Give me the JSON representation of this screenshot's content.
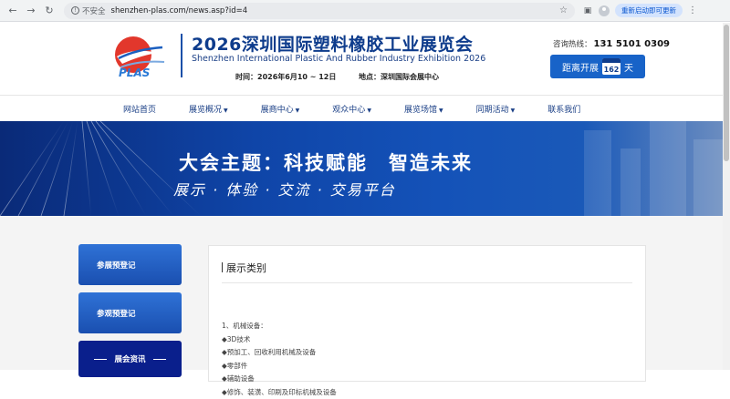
{
  "browser": {
    "insecure_label": "不安全",
    "url": "shenzhen-plas.com/news.asp?id=4",
    "restart_label": "重新启动即可更新"
  },
  "header": {
    "logo_text": "PLAS",
    "title_cn": "2026深圳国际塑料橡胶工业展览会",
    "title_en": "Shenzhen International Plastic And Rubber Industry Exhibition 2026",
    "time_label": "时间：",
    "time_value": "2026年6月10 ~ 12日",
    "place_label": "地点：",
    "place_value": "深圳国际会展中心",
    "hotline_label": "咨询热线：",
    "hotline_number": "131 5101 0309",
    "countdown_prefix": "距离开展",
    "countdown_days": "162",
    "countdown_suffix": "天"
  },
  "nav": {
    "items": [
      {
        "label": "网站首页",
        "dropdown": false
      },
      {
        "label": "展览概况",
        "dropdown": true
      },
      {
        "label": "展商中心",
        "dropdown": true
      },
      {
        "label": "观众中心",
        "dropdown": true
      },
      {
        "label": "展览场馆",
        "dropdown": true
      },
      {
        "label": "同期活动",
        "dropdown": true
      },
      {
        "label": "联系我们",
        "dropdown": false
      }
    ]
  },
  "banner": {
    "title": "大会主题：科技赋能　智造未来",
    "subtitle": "展示 · 体验 · 交流 · 交易平台"
  },
  "sidebar": {
    "btn1": "参展预登记",
    "btn2": "参观预登记",
    "btn3": "展会资讯"
  },
  "panel": {
    "title": "展示类别",
    "lines": [
      "1、机械设备：",
      "◆3D技术",
      "◆预加工、回收利用机械及设备",
      "◆零部件",
      "◆辅助设备",
      "◆修饰、装潢、印刷及印标机械及设备"
    ]
  },
  "colors": {
    "brand_blue": "#0e3c8c",
    "accent_blue": "#1863c8",
    "nav_text": "#1a3f86"
  }
}
